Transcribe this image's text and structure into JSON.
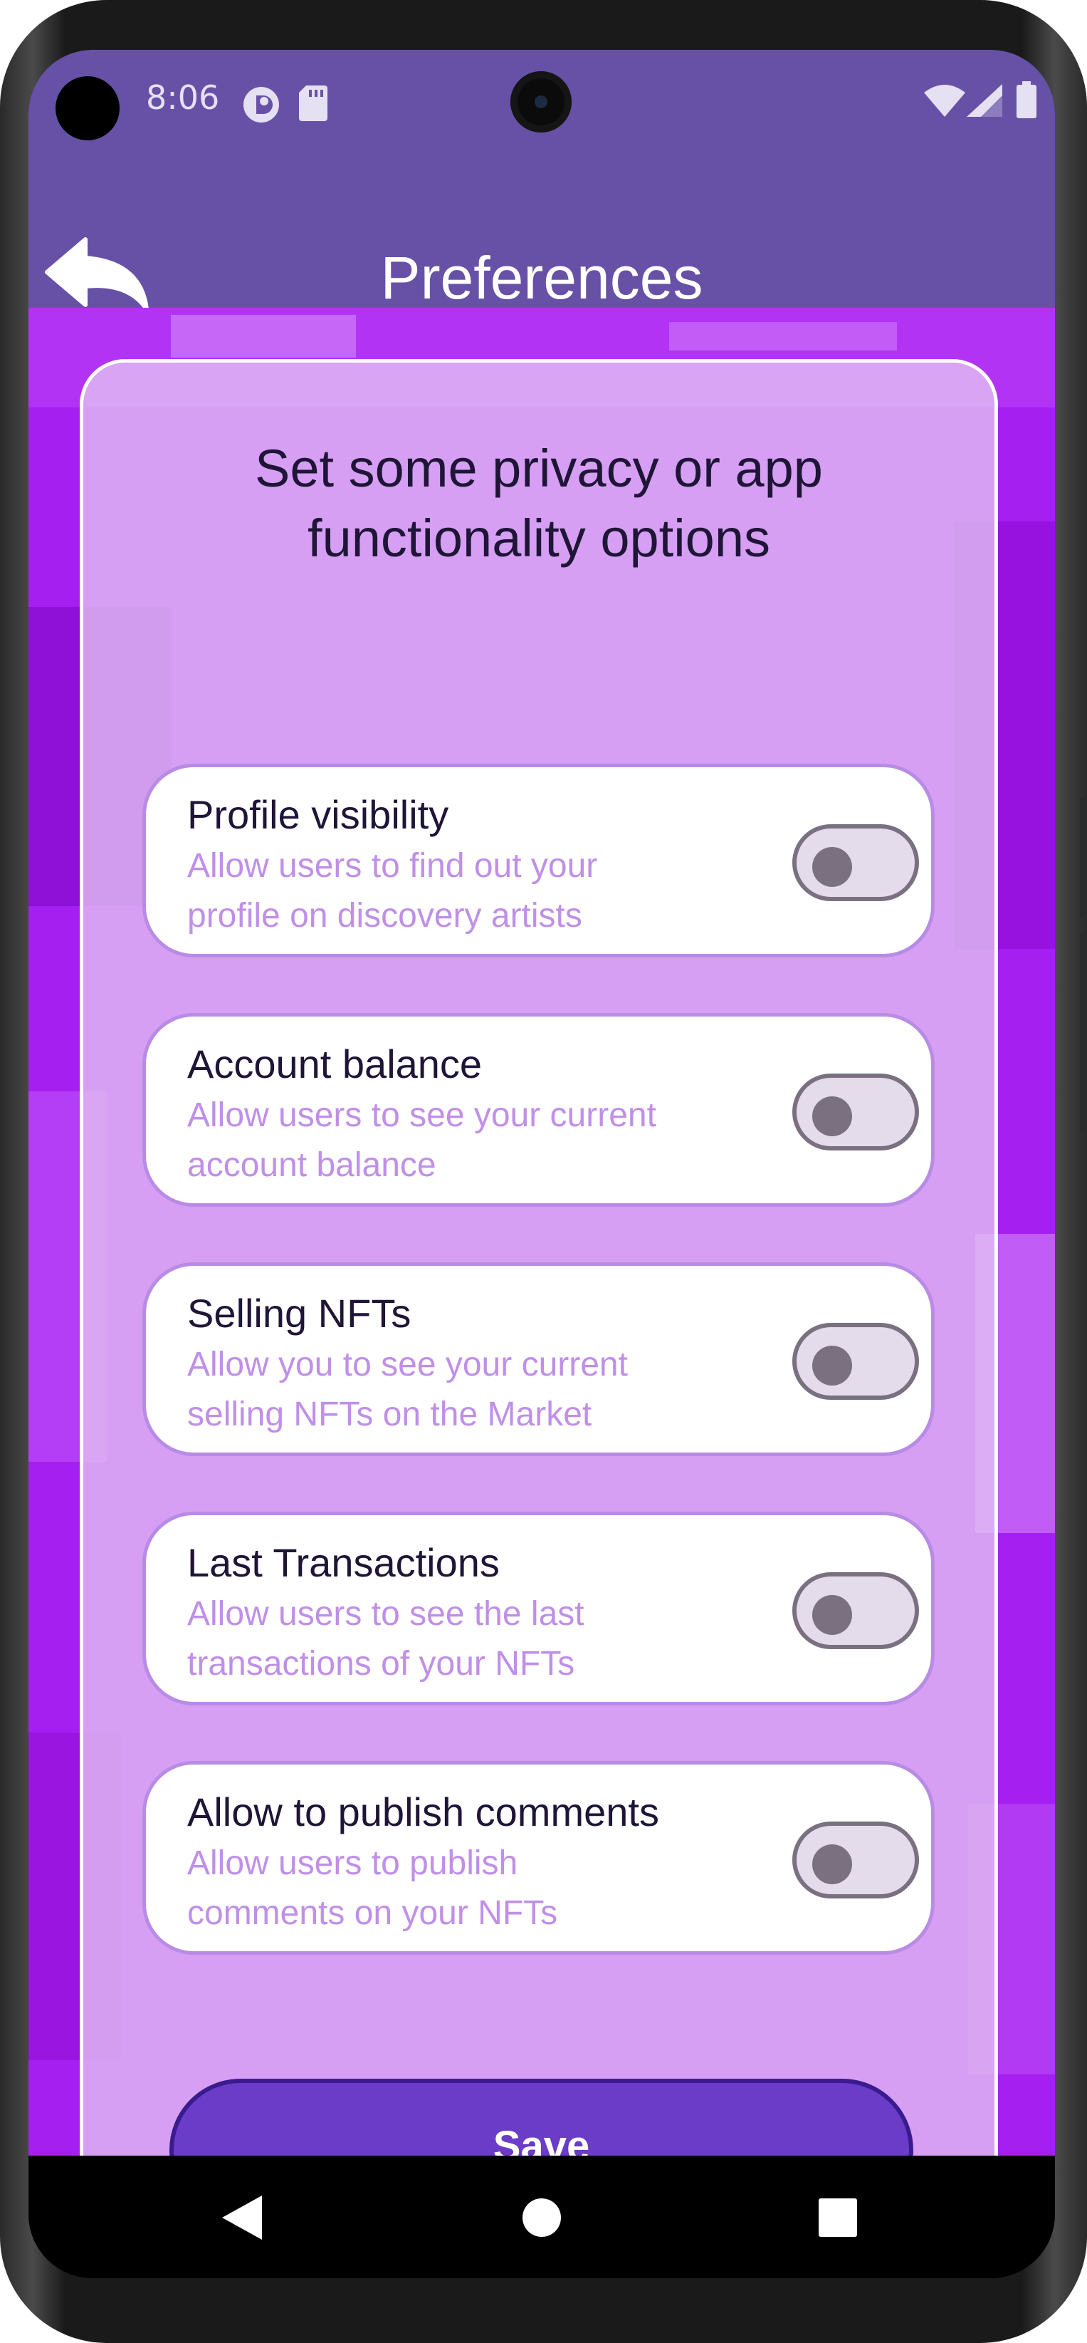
{
  "status_bar": {
    "time": "8:06",
    "icons": [
      "media-icon",
      "sd-card-icon",
      "wifi-icon",
      "signal-icon",
      "battery-icon"
    ]
  },
  "app_bar": {
    "title": "Preferences",
    "back_icon": "back-arrow-icon"
  },
  "main": {
    "heading_line1": "Set some privacy or app",
    "heading_line2": "functionality options",
    "options": [
      {
        "title": "Profile visibility",
        "desc1": "Allow users to find out your",
        "desc2": "profile on discovery artists",
        "enabled": false
      },
      {
        "title": "Account balance",
        "desc1": "Allow users to see your current",
        "desc2": "account balance",
        "enabled": false
      },
      {
        "title": "Selling NFTs",
        "desc1": "Allow you to see your current",
        "desc2": "selling NFTs on the Market",
        "enabled": false
      },
      {
        "title": "Last Transactions",
        "desc1": "Allow users to see the last",
        "desc2": "transactions of your NFTs",
        "enabled": false
      },
      {
        "title": "Allow to publish comments",
        "desc1": "Allow users to publish",
        "desc2": "comments on your NFTs",
        "enabled": false
      }
    ],
    "save_label": "Save"
  },
  "nav_bar": {
    "icons": [
      "back-triangle-icon",
      "home-circle-icon",
      "recents-square-icon"
    ]
  },
  "colors": {
    "app_bar": "#6751a6",
    "background_purple": "#a51ff0",
    "option_border": "#b88be6",
    "description_text": "#c08fe8",
    "save_button": "#6a3cc8"
  }
}
